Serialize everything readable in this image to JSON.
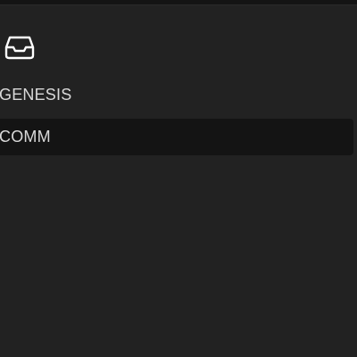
{
  "sidebar": {
    "inbox_icon": "inbox-tray-icon",
    "items": [
      {
        "label": "GENESIS",
        "selected": false
      },
      {
        "label": "COMM",
        "selected": true
      }
    ]
  },
  "colors": {
    "background": "#222222",
    "selected_item_bg": "#141414",
    "text": "#d9d9d9"
  }
}
